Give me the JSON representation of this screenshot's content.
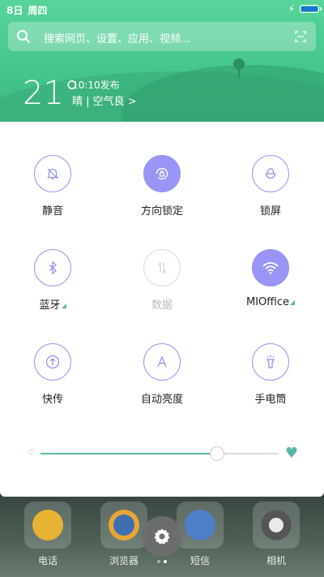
{
  "status": {
    "date": "8日",
    "weekday": "周四"
  },
  "search": {
    "placeholder": "搜索网页、设置、应用、视频..."
  },
  "weather": {
    "temperature": "21°",
    "publish_time": "10:10发布",
    "condition": "晴 | 空气良 >"
  },
  "toggles": [
    {
      "label": "静音",
      "icon": "bell-off-icon",
      "state": "off"
    },
    {
      "label": "方向锁定",
      "icon": "rotation-lock-icon",
      "state": "on"
    },
    {
      "label": "锁屏",
      "icon": "lock-icon",
      "state": "off"
    },
    {
      "label": "蓝牙",
      "icon": "bluetooth-icon",
      "state": "off"
    },
    {
      "label": "数据",
      "icon": "mobile-data-icon",
      "state": "disabled"
    },
    {
      "label": "MIOffice",
      "icon": "wifi-icon",
      "state": "on"
    },
    {
      "label": "快传",
      "icon": "quick-share-icon",
      "state": "off"
    },
    {
      "label": "自动亮度",
      "icon": "auto-brightness-icon",
      "state": "off"
    },
    {
      "label": "手电筒",
      "icon": "flashlight-icon",
      "state": "off"
    }
  ],
  "brightness": {
    "level": 0.74
  },
  "dock": [
    {
      "label": "电话",
      "icon": "phone-icon"
    },
    {
      "label": "浏览器",
      "icon": "browser-icon"
    },
    {
      "label": "短信",
      "icon": "messages-icon"
    },
    {
      "label": "相机",
      "icon": "camera-icon"
    }
  ],
  "colors": {
    "accent": "#9994f6",
    "header": "#4ccb91",
    "slider": "#5ab6a9"
  }
}
